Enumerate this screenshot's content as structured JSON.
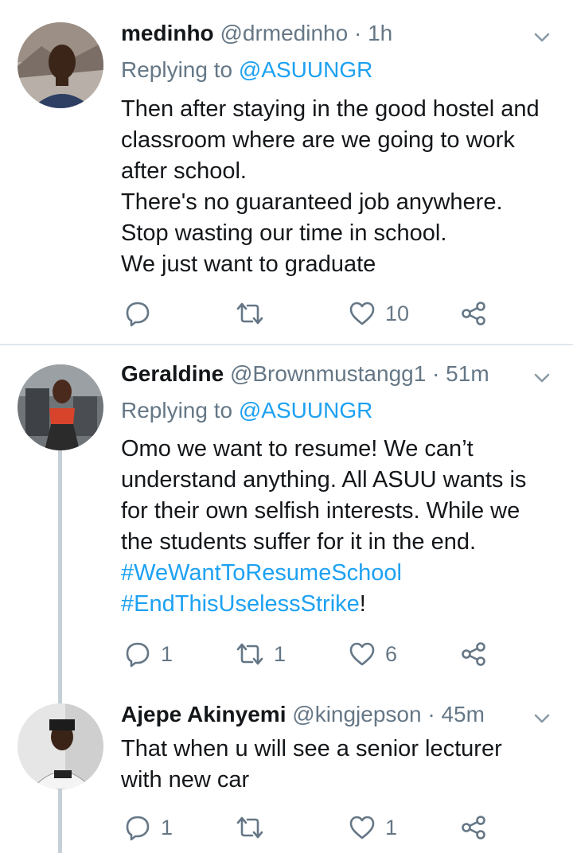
{
  "tweets": [
    {
      "name": "medinho",
      "handle": "@drmedinho",
      "time": "1h",
      "replying_label": "Replying to",
      "replying_handle": "@ASUUNGR",
      "lines": [
        "Then after staying in the good hostel and",
        "classroom where are we going to work",
        "after school.",
        "There's no guaranteed job anywhere.",
        "Stop wasting our time in school.",
        "We just want to graduate"
      ],
      "reply_count": "",
      "retweet_count": "",
      "like_count": "10"
    },
    {
      "name": "Geraldine",
      "handle": "@Brownmustangg1",
      "time": "51m",
      "replying_label": "Replying to",
      "replying_handle": "@ASUUNGR",
      "lines": [
        "Omo we want to resume! We can’t",
        "understand anything. All ASUU wants is",
        "for their own selfish interests. While we",
        "the students suffer for it in the end."
      ],
      "hashtag1": "#WeWantToResumeSchool",
      "hashtag2": "#EndThisUselessStrike",
      "hashtag2_suffix": "!",
      "reply_count": "1",
      "retweet_count": "1",
      "like_count": "6"
    },
    {
      "name": "Ajepe Akinyemi",
      "handle": "@kingjepson",
      "time": "45m",
      "lines": [
        "That when u will see a senior lecturer",
        "with new car"
      ],
      "reply_count": "1",
      "retweet_count": "",
      "like_count": "1"
    }
  ],
  "separator": " · ",
  "colors": {
    "link": "#1da1f2",
    "muted": "#657786",
    "thread_line": "#c4cfd6",
    "divider": "#e1e8ed"
  },
  "icons": [
    "reply-icon",
    "retweet-icon",
    "like-icon",
    "share-icon",
    "chevron-down-icon"
  ]
}
